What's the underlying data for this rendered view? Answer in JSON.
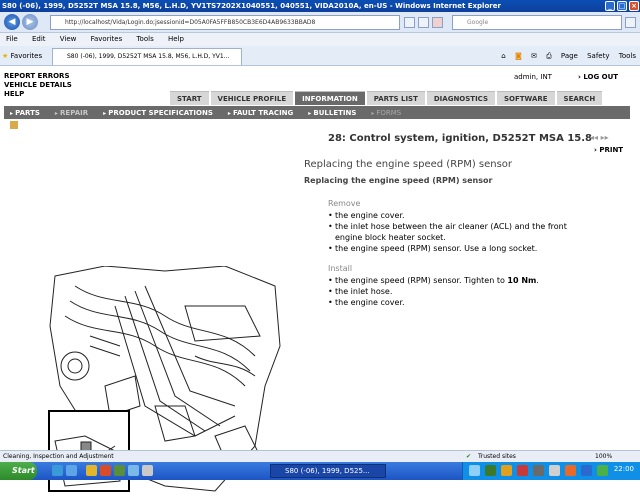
{
  "window": {
    "title": "S80 (-06), 1999, D5252T MSA 15.8, M56, L.H.D, YV1TS7202X1040551, 040551, VIDA2010A, en-US - Windows Internet Explorer"
  },
  "browser": {
    "address": "http://localhost/Vida/Login.do;jsessionid=D05A0FA5FFB850CB3E6D4AB9633BBAD8",
    "search_placeholder": "Google",
    "menu": [
      "File",
      "Edit",
      "View",
      "Favorites",
      "Tools",
      "Help"
    ],
    "favorites_label": "Favorites",
    "tab_title": "S80 (-06), 1999, D5252T MSA 15.8, M56, L.H.D, YV1...",
    "commands": [
      "Page",
      "Safety",
      "Tools"
    ]
  },
  "app": {
    "top_links": [
      "REPORT ERRORS",
      "VEHICLE DETAILS",
      "HELP"
    ],
    "user": "admin, INT",
    "logout": "LOG OUT",
    "main_tabs": [
      "START",
      "VEHICLE PROFILE",
      "INFORMATION",
      "PARTS LIST",
      "DIAGNOSTICS",
      "SOFTWARE",
      "SEARCH"
    ],
    "active_tab": "INFORMATION",
    "sub_nav": [
      "PARTS",
      "REPAIR",
      "PRODUCT SPECIFICATIONS",
      "FAULT TRACING",
      "BULLETINS",
      "FORMS"
    ],
    "doc_heading": "28: Control system, ignition, D5252T MSA 15.8",
    "print_label": "PRINT",
    "doc_title": "Replacing the engine speed (RPM) sensor",
    "doc_subtitle": "Replacing the engine speed (RPM) sensor",
    "remove_label": "Remove",
    "remove_items": [
      "the engine cover.",
      "the inlet hose between the air cleaner (ACL) and the front engine block heater socket.",
      "the engine speed (RPM) sensor. Use a long socket."
    ],
    "install_label": "Install",
    "install_item_1_prefix": "the engine speed (RPM) sensor. Tighten to ",
    "install_item_1_bold": "10 Nm",
    "install_item_1_suffix": ".",
    "install_items_rest": [
      "the inlet hose.",
      "the engine cover."
    ]
  },
  "statusbar": {
    "left": "Cleaning, Inspection and Adjustment",
    "zone": "Trusted sites",
    "zoom": "100%"
  },
  "taskbar": {
    "start": "Start",
    "app": "S80 (-06), 1999, D525...",
    "clock": "22:00"
  }
}
